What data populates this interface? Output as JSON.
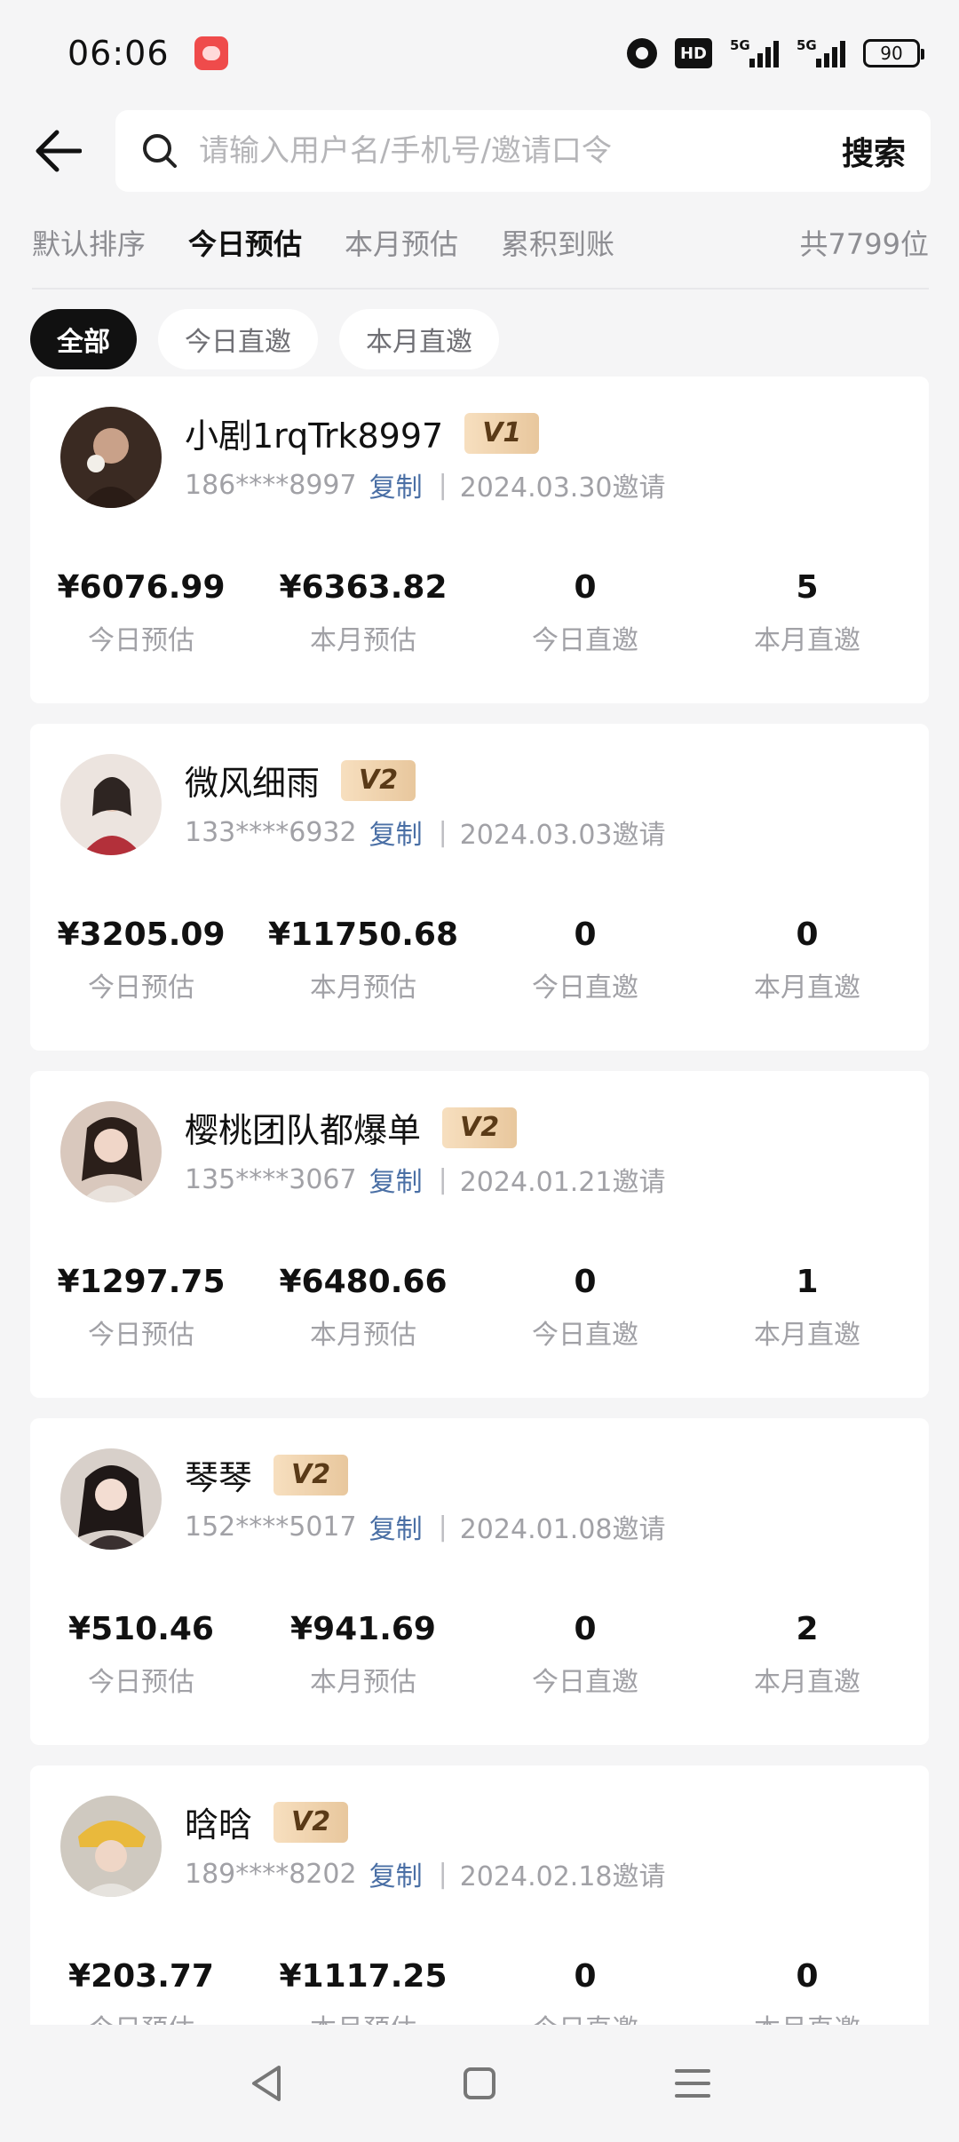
{
  "status_bar": {
    "time": "06:06",
    "hd_label": "HD",
    "network_labels": [
      "5G",
      "5G"
    ],
    "battery": "90"
  },
  "header": {
    "search_placeholder": "请输入用户名/手机号/邀请口令",
    "search_button": "搜索"
  },
  "sort_tabs": [
    "默认排序",
    "今日预估",
    "本月预估",
    "累积到账"
  ],
  "active_sort_tab": "今日预估",
  "total_count": "共7799位",
  "filter_chips": [
    "全部",
    "今日直邀",
    "本月直邀"
  ],
  "active_filter": "全部",
  "copy_label": "复制",
  "stat_labels": [
    "今日预估",
    "本月预估",
    "今日直邀",
    "本月直邀"
  ],
  "members": [
    {
      "name": "小剧1rqTrk8997",
      "level": "V1",
      "phone": "186****8997",
      "invite_date": "2024.03.30邀请",
      "stats": [
        "¥6076.99",
        "¥6363.82",
        "0",
        "5"
      ],
      "avatar_color": "#3a2a22"
    },
    {
      "name": "微风细雨",
      "level": "V2",
      "phone": "133****6932",
      "invite_date": "2024.03.03邀请",
      "stats": [
        "¥3205.09",
        "¥11750.68",
        "0",
        "0"
      ],
      "avatar_color": "#e8dcd6"
    },
    {
      "name": "樱桃团队都爆单",
      "level": "V2",
      "phone": "135****3067",
      "invite_date": "2024.01.21邀请",
      "stats": [
        "¥1297.75",
        "¥6480.66",
        "0",
        "1"
      ],
      "avatar_color": "#c9b3a6"
    },
    {
      "name": "琴琴",
      "level": "V2",
      "phone": "152****5017",
      "invite_date": "2024.01.08邀请",
      "stats": [
        "¥510.46",
        "¥941.69",
        "0",
        "2"
      ],
      "avatar_color": "#d8ccc4"
    },
    {
      "name": "晗晗",
      "level": "V2",
      "phone": "189****8202",
      "invite_date": "2024.02.18邀请",
      "stats": [
        "¥203.77",
        "¥1117.25",
        "0",
        "0"
      ],
      "avatar_color": "#cfc6b8"
    }
  ],
  "colors": {
    "background": "#f5f5f6",
    "accent_link": "#4a6fa5",
    "vip_badge": "#e8c79d",
    "active_chip": "#111111"
  }
}
